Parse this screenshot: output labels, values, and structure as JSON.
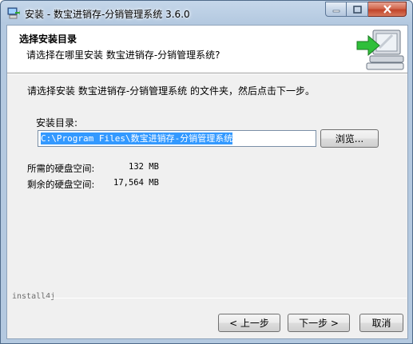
{
  "window": {
    "title": "安装 - 数宝进销存-分销管理系统 3.6.0",
    "icon": "installer-app-icon",
    "controls": [
      "minimize",
      "maximize",
      "close"
    ]
  },
  "header": {
    "title": "选择安装目录",
    "subtitle": "请选择在哪里安装 数宝进销存-分销管理系统?",
    "art_icon": "computer-with-green-arrow-icon"
  },
  "main": {
    "instruction": "请选择安装 数宝进销存-分销管理系统 的文件夹，然后点击下一步。",
    "dir_label": "安装目录:",
    "dir_value": "C:\\Program Files\\数宝进销存-分销管理系统",
    "browse_label": "浏览...",
    "required_label": "所需的硬盘空间:",
    "required_value": "132 MB",
    "free_label": "剩余的硬盘空间:",
    "free_value": "17,564 MB"
  },
  "footer": {
    "brand": "install4j",
    "back_label": "< 上一步",
    "next_label": "下一步 >",
    "cancel_label": "取消"
  },
  "colors": {
    "selection": "#3399ff",
    "close_button": "#c0442a",
    "titlebar": "#b4c9e0"
  }
}
